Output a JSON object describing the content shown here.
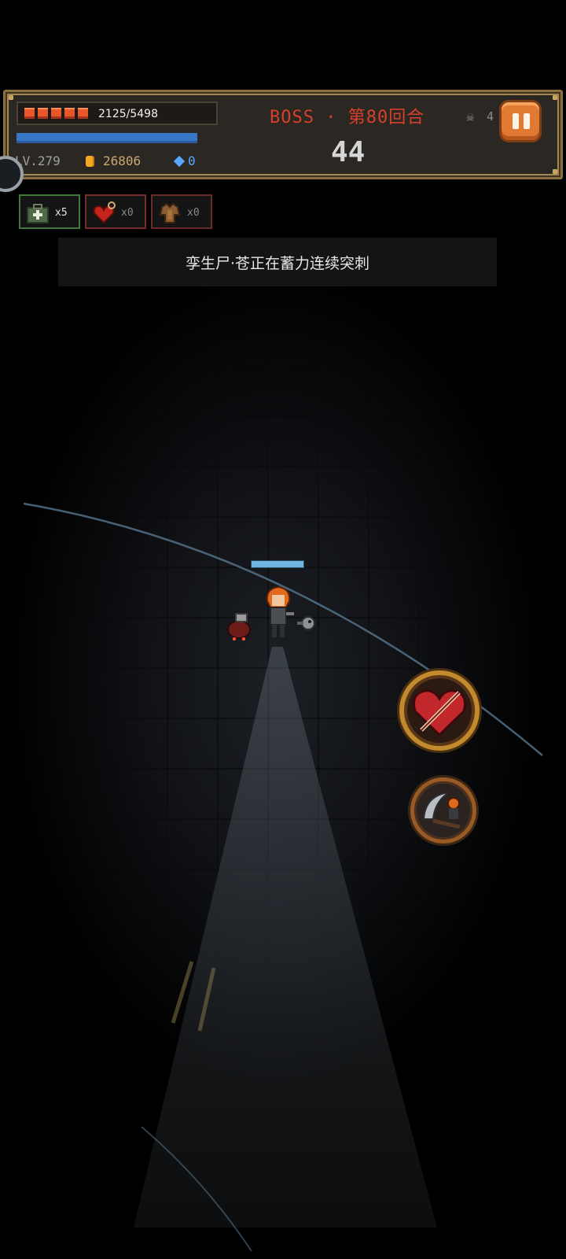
{
  "hud": {
    "hp_text": "2125/5498",
    "hp_fraction": 0.39,
    "mp_fraction": 1.0,
    "level": "LV.279",
    "coins": "26806",
    "gems": "0",
    "round_title": "BOSS · 第80回合",
    "timer": "44",
    "kill_count": "4",
    "skull_icon": "skull-icon",
    "pause_icon": "pause-icon"
  },
  "items": [
    {
      "icon": "medkit-icon",
      "count": "x5",
      "border": "#3f7a3a",
      "count_color": "#e6e6e6"
    },
    {
      "icon": "heart-potion-icon",
      "count": "x0",
      "border": "#7a2a2a",
      "count_color": "#8a8a8a"
    },
    {
      "icon": "armor-icon",
      "count": "x0",
      "border": "#6a2a2a",
      "count_color": "#8a8a8a"
    }
  ],
  "message": "孪生尸·苍正在蓄力连续突刺",
  "boss_hp_fraction": 1.0,
  "skills": [
    {
      "icon": "heart-slash-skill-icon"
    },
    {
      "icon": "scythe-skill-icon"
    }
  ],
  "colors": {
    "hp": "#e8562a",
    "mp": "#3878c9",
    "round_title": "#d8402c",
    "pause_button": "#e07a33",
    "gem": "#5aa7ff",
    "coin": "#f5a623"
  }
}
